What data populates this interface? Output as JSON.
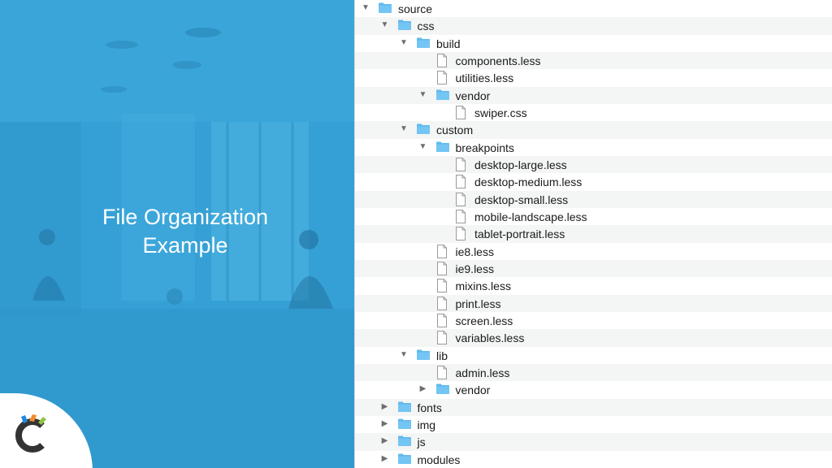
{
  "slide": {
    "title_line1": "File Organization",
    "title_line2": "Example"
  },
  "colors": {
    "panel_blue": "#3aa3d6",
    "folder_blue": "#5fb9ed",
    "logo_orange": "#f28c28",
    "logo_green": "#8cc63f",
    "logo_blue": "#1e88e5",
    "logo_dark": "#333333"
  },
  "tree": [
    {
      "label": "source",
      "type": "folder",
      "expanded": true,
      "depth": 0
    },
    {
      "label": "css",
      "type": "folder",
      "expanded": true,
      "depth": 1
    },
    {
      "label": "build",
      "type": "folder",
      "expanded": true,
      "depth": 2
    },
    {
      "label": "components.less",
      "type": "file",
      "depth": 3
    },
    {
      "label": "utilities.less",
      "type": "file",
      "depth": 3
    },
    {
      "label": "vendor",
      "type": "folder",
      "expanded": true,
      "depth": 3
    },
    {
      "label": "swiper.css",
      "type": "file",
      "depth": 4
    },
    {
      "label": "custom",
      "type": "folder",
      "expanded": true,
      "depth": 2
    },
    {
      "label": "breakpoints",
      "type": "folder",
      "expanded": true,
      "depth": 3
    },
    {
      "label": "desktop-large.less",
      "type": "file",
      "depth": 4
    },
    {
      "label": "desktop-medium.less",
      "type": "file",
      "depth": 4
    },
    {
      "label": "desktop-small.less",
      "type": "file",
      "depth": 4
    },
    {
      "label": "mobile-landscape.less",
      "type": "file",
      "depth": 4
    },
    {
      "label": "tablet-portrait.less",
      "type": "file",
      "depth": 4
    },
    {
      "label": "ie8.less",
      "type": "file",
      "depth": 3
    },
    {
      "label": "ie9.less",
      "type": "file",
      "depth": 3
    },
    {
      "label": "mixins.less",
      "type": "file",
      "depth": 3
    },
    {
      "label": "print.less",
      "type": "file",
      "depth": 3
    },
    {
      "label": "screen.less",
      "type": "file",
      "depth": 3
    },
    {
      "label": "variables.less",
      "type": "file",
      "depth": 3
    },
    {
      "label": "lib",
      "type": "folder",
      "expanded": true,
      "depth": 2
    },
    {
      "label": "admin.less",
      "type": "file",
      "depth": 3
    },
    {
      "label": "vendor",
      "type": "folder",
      "expanded": false,
      "depth": 3
    },
    {
      "label": "fonts",
      "type": "folder",
      "expanded": false,
      "depth": 1
    },
    {
      "label": "img",
      "type": "folder",
      "expanded": false,
      "depth": 1
    },
    {
      "label": "js",
      "type": "folder",
      "expanded": false,
      "depth": 1
    },
    {
      "label": "modules",
      "type": "folder",
      "expanded": false,
      "depth": 1
    }
  ]
}
